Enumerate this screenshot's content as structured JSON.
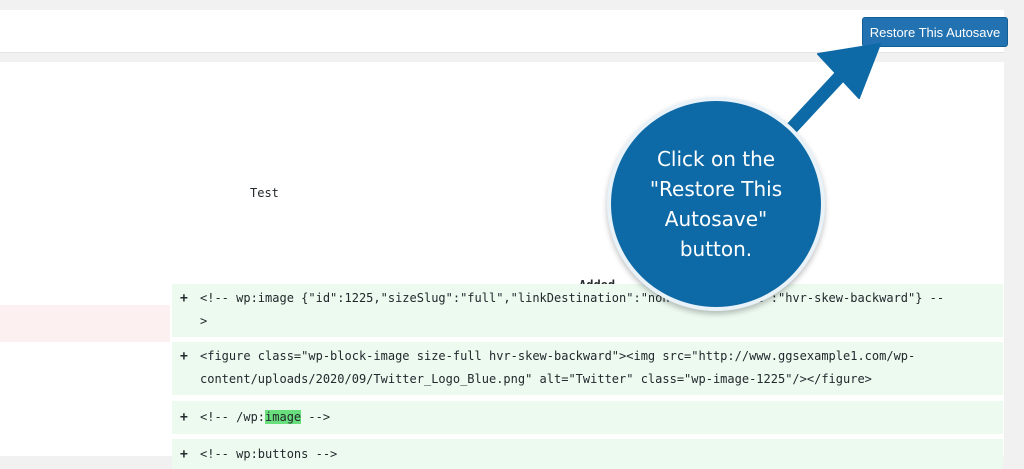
{
  "toolbar": {
    "restore_label": "Restore This Autosave"
  },
  "diff": {
    "left_text": "Test",
    "added_text": "Added",
    "rows": [
      {
        "marker": "+",
        "line1": "<!-- wp:image {\"id\":1225,\"sizeSlug\":\"full\",\"linkDestination\":\"none\",\"className\":\"hvr-skew-backward\"} --",
        "line2": ">"
      },
      {
        "marker": "+",
        "line1": "<figure class=\"wp-block-image size-full hvr-skew-backward\"><img src=\"http://www.ggsexample1.com/wp-",
        "line2": "content/uploads/2020/09/Twitter_Logo_Blue.png\" alt=\"Twitter\" class=\"wp-image-1225\"/></figure>"
      },
      {
        "marker": "+",
        "pre": "<!-- /wp:",
        "highlight": "image",
        "post": " -->"
      },
      {
        "marker": "+",
        "line1": "<!-- wp:buttons -->"
      }
    ]
  },
  "callout": {
    "lines": [
      "Click on the",
      "\"Restore This",
      "Autosave\"",
      "button."
    ],
    "color": "#0e6aa6"
  }
}
